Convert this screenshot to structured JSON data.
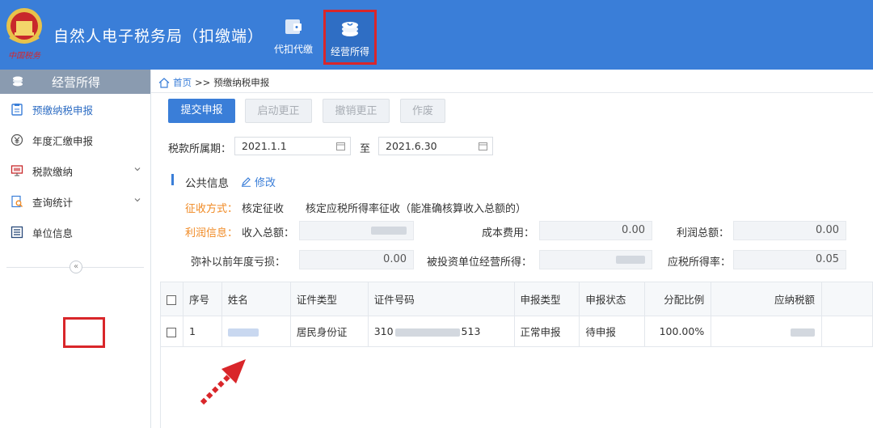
{
  "header": {
    "title": "自然人电子税务局（扣缴端）",
    "emblem_text": "中国税务",
    "nav": [
      {
        "label": "代扣代缴",
        "icon": "wallet-icon"
      },
      {
        "label": "经营所得",
        "icon": "coins-icon",
        "selected": true
      }
    ]
  },
  "sidebar": {
    "title": "经营所得",
    "items": [
      {
        "label": "预缴纳税申报",
        "icon": "clipboard-icon",
        "active": true
      },
      {
        "label": "年度汇缴申报",
        "icon": "yen-icon"
      },
      {
        "label": "税款缴纳",
        "icon": "monitor-icon",
        "expandable": true
      },
      {
        "label": "查询统计",
        "icon": "search-doc-icon",
        "expandable": true
      },
      {
        "label": "单位信息",
        "icon": "list-icon"
      }
    ],
    "collapse_glyph": "«"
  },
  "breadcrumb": {
    "home": "首页",
    "separator": ">>",
    "current": "预缴纳税申报"
  },
  "toolbar": {
    "submit": "提交申报",
    "start_correction": "启动更正",
    "cancel_correction": "撤销更正",
    "void": "作废"
  },
  "period": {
    "label": "税款所属期：",
    "from": "2021.1.1",
    "to_label": "至",
    "to": "2021.6.30"
  },
  "public_info": {
    "title": "公共信息",
    "edit": "修改",
    "collect_label": "征收方式：",
    "collect_value": "核定征收",
    "collect_desc": "核定应税所得率征收（能准确核算收入总额的）",
    "profit_label": "利润信息：",
    "fields": {
      "income_total_label": "收入总额：",
      "cost_label": "成本费用：",
      "cost_value": "0.00",
      "profit_total_label": "利润总额：",
      "profit_total_value": "0.00",
      "loss_label": "弥补以前年度亏损：",
      "loss_value": "0.00",
      "invested_label": "被投资单位经营所得：",
      "rate_label": "应税所得率：",
      "rate_value": "0.05"
    }
  },
  "table": {
    "columns": [
      "序号",
      "姓名",
      "证件类型",
      "证件号码",
      "申报类型",
      "申报状态",
      "分配比例",
      "应纳税额"
    ],
    "rows": [
      {
        "index": "1",
        "id_type": "居民身份证",
        "id_prefix": "310",
        "id_suffix": "513",
        "decl_type": "正常申报",
        "status": "待申报",
        "ratio": "100.00%"
      }
    ]
  },
  "colors": {
    "header_blue": "#3a7ed8",
    "highlight_red": "#d9262a",
    "accent_orange": "#f08a24"
  }
}
